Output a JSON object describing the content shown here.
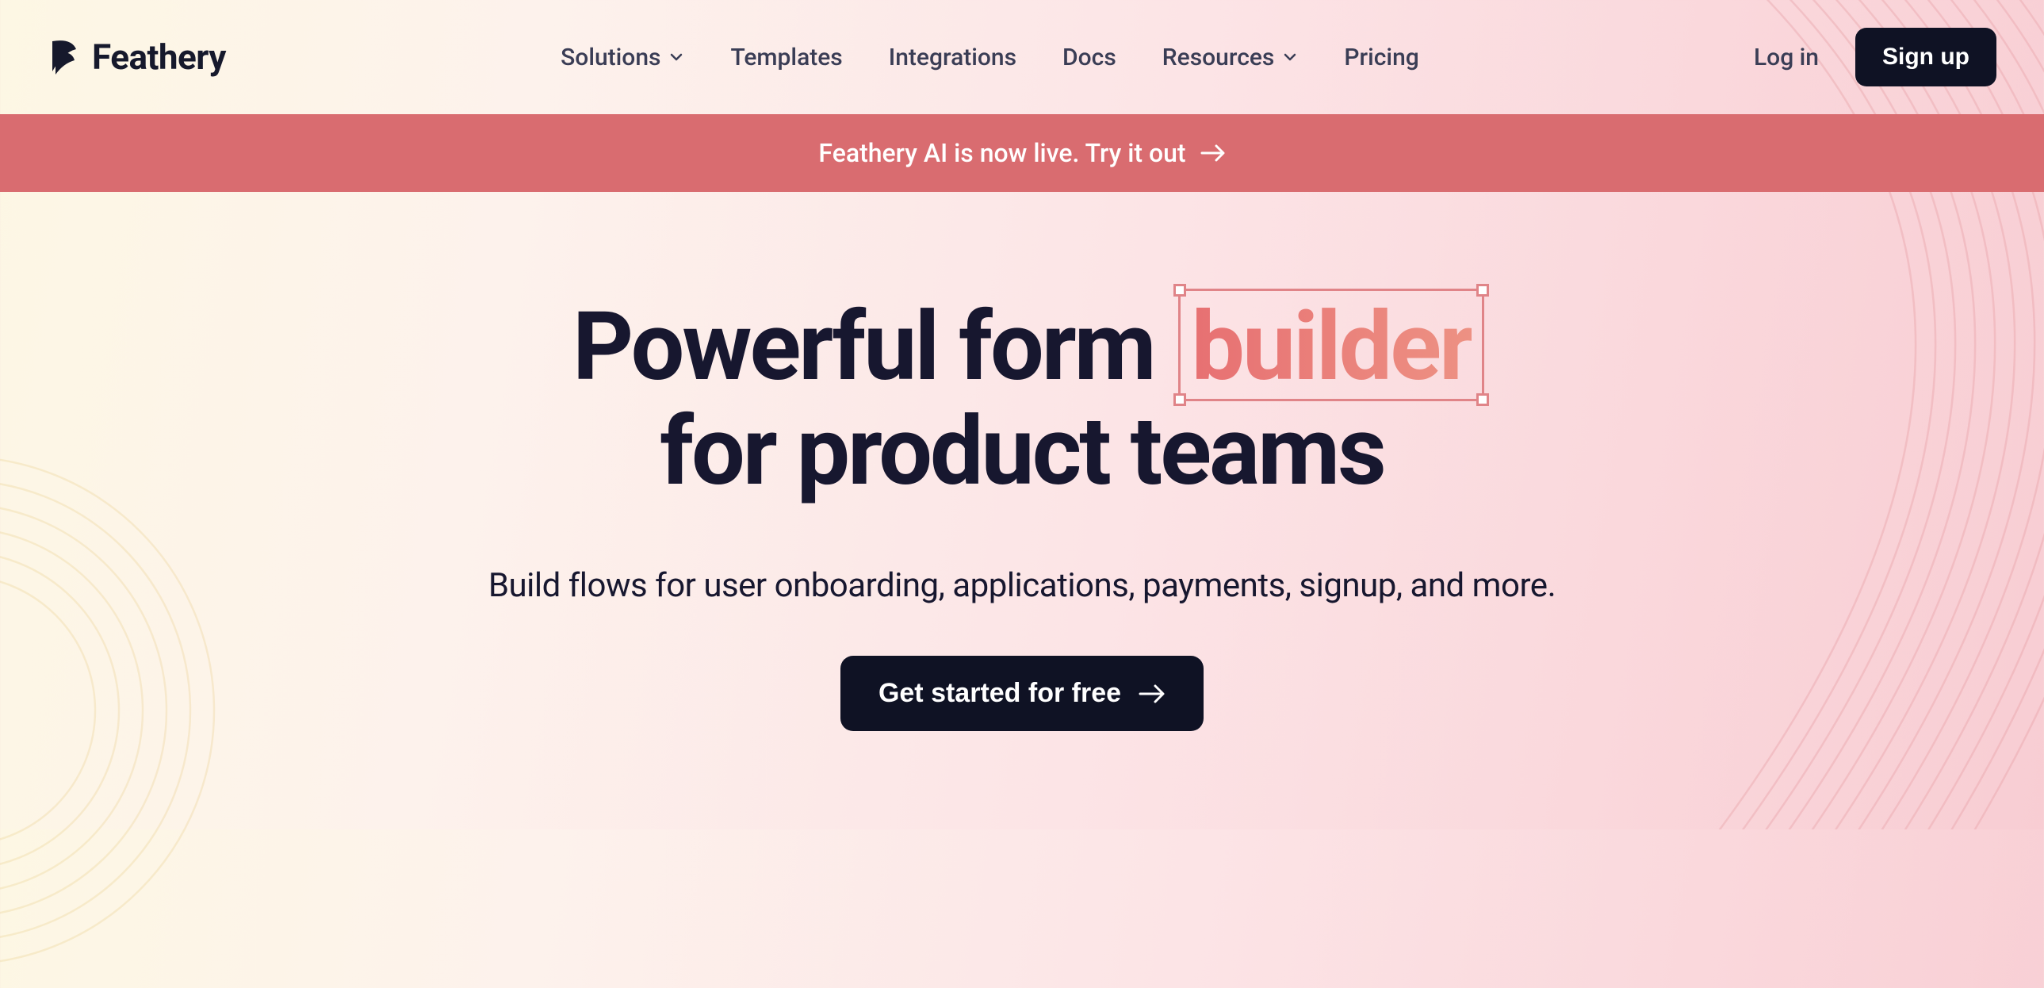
{
  "brand": {
    "name": "Feathery"
  },
  "nav": {
    "solutions": "Solutions",
    "templates": "Templates",
    "integrations": "Integrations",
    "docs": "Docs",
    "resources": "Resources",
    "pricing": "Pricing"
  },
  "auth": {
    "login": "Log in",
    "signup": "Sign up"
  },
  "banner": {
    "text": "Feathery AI is now live. Try it out"
  },
  "hero": {
    "title_pre": "Powerful form",
    "title_highlight": "builder",
    "title_line2": "for product teams",
    "subtitle": "Build flows for user onboarding, applications, payments, signup, and more.",
    "cta": "Get started for free"
  }
}
